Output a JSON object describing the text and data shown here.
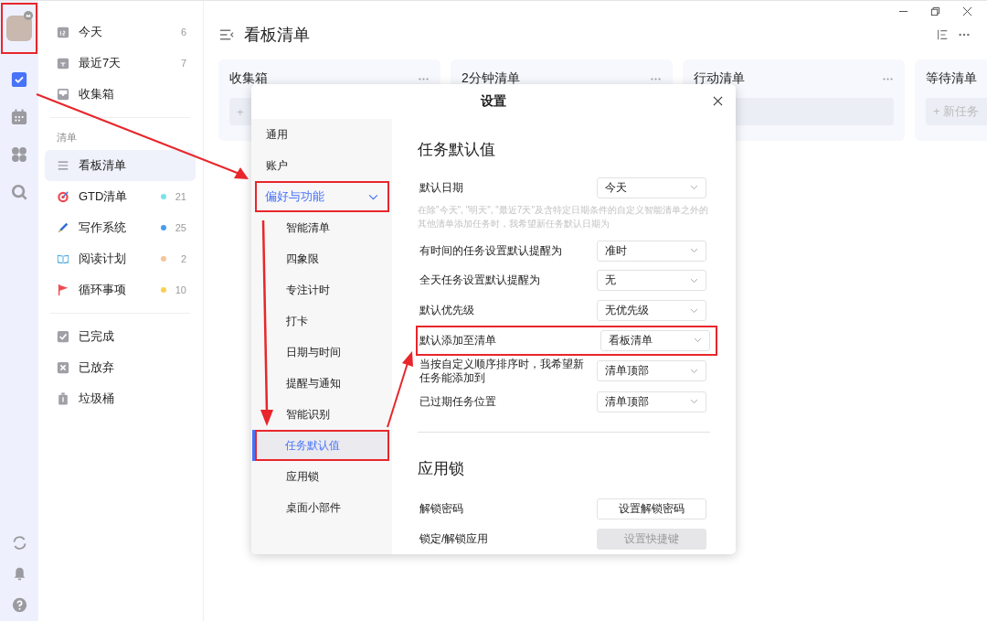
{
  "rail": {
    "avatar": {
      "highlighted": true
    },
    "items": [
      {
        "kind": "tasks",
        "selected": true
      },
      {
        "kind": "calendar",
        "selected": false
      },
      {
        "kind": "grid",
        "selected": false
      },
      {
        "kind": "search",
        "selected": false
      }
    ],
    "bottom": [
      {
        "kind": "sync"
      },
      {
        "kind": "bell"
      },
      {
        "kind": "help"
      }
    ]
  },
  "sidebar": {
    "smart": [
      {
        "label": "今天",
        "count": "6"
      },
      {
        "label": "最近7天",
        "count": "7"
      },
      {
        "label": "收集箱"
      }
    ],
    "section_label": "清单",
    "lists": [
      {
        "label": "看板清单",
        "selected": true
      },
      {
        "label": "GTD清单",
        "count": "21",
        "color": "#7ae3e8",
        "selected": false
      },
      {
        "label": "写作系统",
        "count": "25",
        "color": "#4a9cf0",
        "selected": false
      },
      {
        "label": "阅读计划",
        "count": "2",
        "color": "#f6c59a",
        "selected": false
      },
      {
        "label": "循环事项",
        "count": "10",
        "color": "#f9d14f",
        "selected": false
      }
    ],
    "closed": [
      {
        "label": "已完成"
      },
      {
        "label": "已放弃"
      },
      {
        "label": "垃圾桶"
      }
    ]
  },
  "board": {
    "title": "看板清单",
    "columns": [
      {
        "title": "收集箱",
        "add_label": "+"
      },
      {
        "title": "2分钟清单"
      },
      {
        "title": "行动清单"
      },
      {
        "title": "等待清单",
        "add_label": "+ 新任务"
      }
    ]
  },
  "dialog": {
    "title": "设置",
    "nav": [
      {
        "label": "通用",
        "selected": false,
        "highlighted": false
      },
      {
        "label": "账户",
        "selected": false,
        "highlighted": false
      },
      {
        "label": "偏好与功能",
        "selected": false,
        "expanded": true,
        "highlighted": true,
        "children": [
          {
            "label": "智能清单",
            "selected": false,
            "highlighted": false
          },
          {
            "label": "四象限",
            "selected": false,
            "highlighted": false
          },
          {
            "label": "专注计时",
            "selected": false,
            "highlighted": false
          },
          {
            "label": "打卡",
            "selected": false,
            "highlighted": false
          },
          {
            "label": "日期与时间",
            "selected": false,
            "highlighted": false
          },
          {
            "label": "提醒与通知",
            "selected": false,
            "highlighted": false
          },
          {
            "label": "智能识别",
            "selected": false,
            "highlighted": false
          },
          {
            "label": "任务默认值",
            "selected": true,
            "highlighted": true
          },
          {
            "label": "应用锁",
            "selected": false,
            "highlighted": false
          },
          {
            "label": "桌面小部件",
            "selected": false,
            "highlighted": false
          }
        ]
      }
    ],
    "sections": [
      {
        "title": "任务默认值",
        "rows": [
          {
            "kind": "select",
            "label": "默认日期",
            "value": "今天",
            "highlighted": false
          },
          {
            "kind": "note",
            "label": "在除\"今天\", \"明天\", \"最近7天\"及含特定日期条件的自定义智能清单之外的其他清单添加任务时，我希望新任务默认日期为"
          },
          {
            "kind": "select",
            "label": "有时间的任务设置默认提醒为",
            "value": "准时",
            "highlighted": false
          },
          {
            "kind": "select",
            "label": "全天任务设置默认提醒为",
            "value": "无",
            "highlighted": false
          },
          {
            "kind": "select",
            "label": "默认优先级",
            "value": "无优先级",
            "highlighted": false
          },
          {
            "kind": "select",
            "label": "默认添加至清单",
            "value": "看板清单",
            "highlighted": true
          },
          {
            "kind": "select",
            "label": "当按自定义顺序排序时，我希望新任务能添加到",
            "value": "清单顶部",
            "highlighted": false
          },
          {
            "kind": "select",
            "label": "已过期任务位置",
            "value": "清单顶部",
            "highlighted": false
          }
        ]
      },
      {
        "title": "应用锁",
        "rows": [
          {
            "kind": "button",
            "label": "解锁密码",
            "value": "设置解锁密码",
            "disabled": false
          },
          {
            "kind": "button",
            "label": "锁定/解锁应用",
            "value": "设置快捷键",
            "disabled": true
          }
        ]
      }
    ]
  }
}
